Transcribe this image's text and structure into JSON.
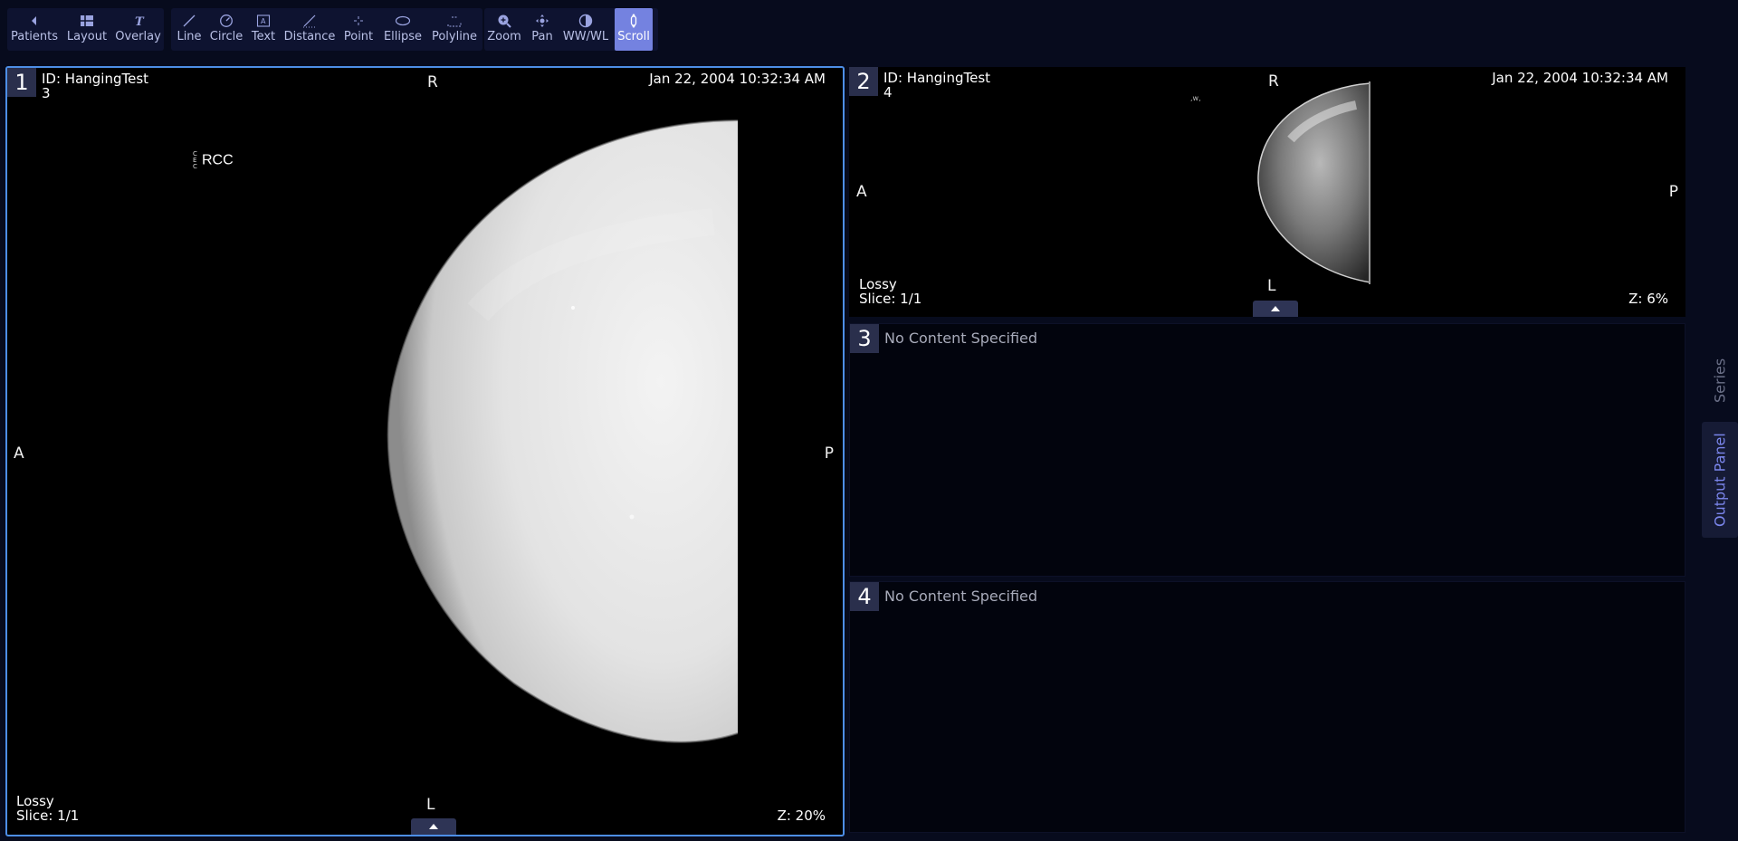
{
  "toolbar": {
    "nav_group": [
      {
        "label": "Patients",
        "icon": "chevron-left-icon"
      },
      {
        "label": "Layout",
        "icon": "layout-icon"
      },
      {
        "label": "Overlay",
        "icon": "overlay-icon"
      }
    ],
    "annotate_group": [
      {
        "label": "Line",
        "icon": "line-icon"
      },
      {
        "label": "Circle",
        "icon": "circle-icon"
      },
      {
        "label": "Text",
        "icon": "text-icon"
      },
      {
        "label": "Distance",
        "icon": "distance-icon"
      },
      {
        "label": "Point",
        "icon": "point-icon"
      },
      {
        "label": "Ellipse",
        "icon": "ellipse-icon"
      },
      {
        "label": "Polyline",
        "icon": "polyline-icon"
      }
    ],
    "view_group": [
      {
        "label": "Zoom",
        "icon": "zoom-icon"
      },
      {
        "label": "Pan",
        "icon": "pan-icon"
      },
      {
        "label": "WW/WL",
        "icon": "contrast-icon"
      },
      {
        "label": "Scroll",
        "icon": "scroll-icon",
        "active": true
      }
    ]
  },
  "viewports": {
    "vp1": {
      "number": "1",
      "id_line": "ID: HangingTest",
      "id_sub": "3",
      "date": "Jan 22, 2004 10:32:34 AM",
      "orient_top": "R",
      "orient_bottom": "L",
      "orient_left": "A",
      "orient_right": "P",
      "view_label": "RCC",
      "compression": "Lossy",
      "slice": "Slice: 1/1",
      "zoom": "Z: 20%"
    },
    "vp2": {
      "number": "2",
      "id_line": "ID: HangingTest",
      "id_sub": "4",
      "date": "Jan 22, 2004 10:32:34 AM",
      "orient_top": "R",
      "orient_bottom": "L",
      "orient_left": "A",
      "orient_right": "P",
      "compression": "Lossy",
      "slice": "Slice: 1/1",
      "zoom": "Z: 6%"
    },
    "vp3": {
      "number": "3",
      "message": "No Content Specified"
    },
    "vp4": {
      "number": "4",
      "message": "No Content Specified"
    }
  },
  "side_panel": {
    "series_label": "Series",
    "output_label": "Output Panel"
  },
  "colors": {
    "background": "#070b1d",
    "accent": "#7482e0",
    "selected_border": "#4d8ee6",
    "output_panel_text": "#7b86ec"
  }
}
